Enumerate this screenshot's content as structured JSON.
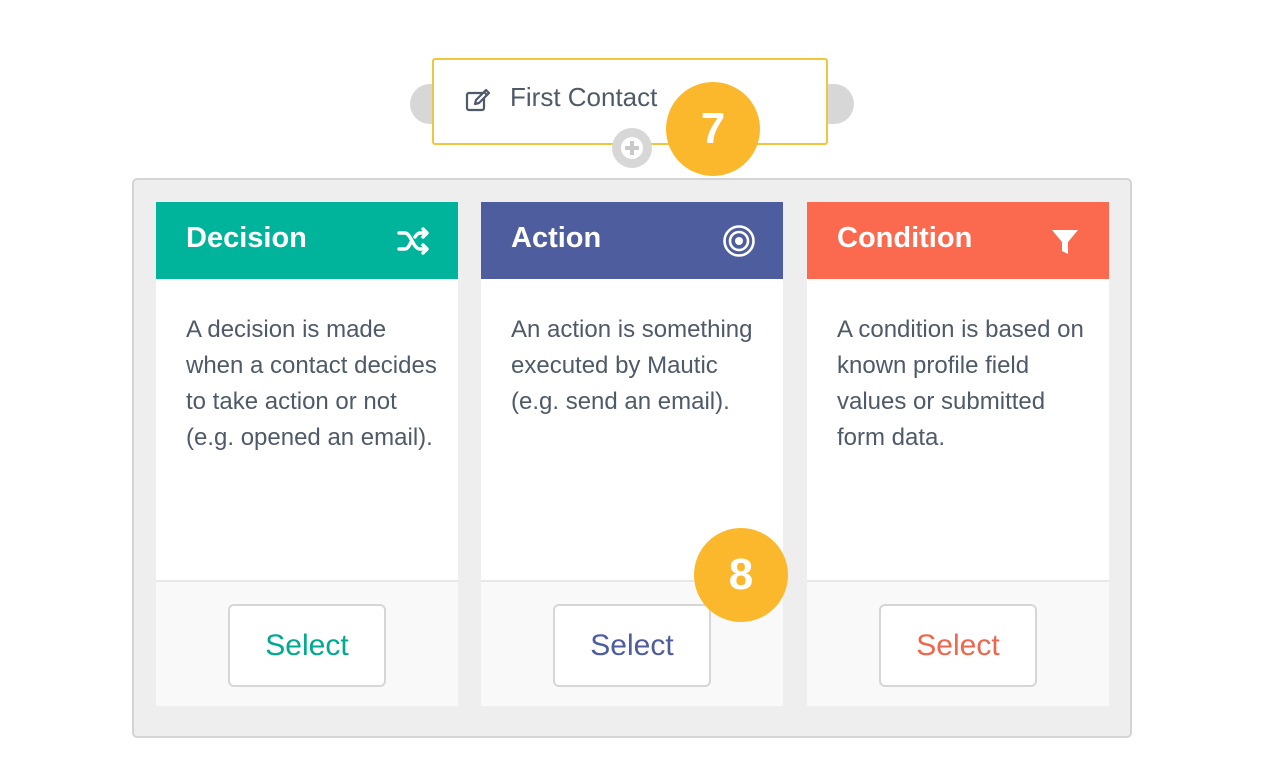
{
  "source_node": {
    "label": "First Contact",
    "icon": "edit-icon"
  },
  "badges": {
    "step_7": "7",
    "step_8": "8"
  },
  "colors": {
    "decision": "#00b49c",
    "action": "#4e5d9d",
    "condition": "#fb6a4f",
    "badge": "#fbb82c",
    "node_border": "#f0c63c"
  },
  "cards": [
    {
      "title": "Decision",
      "icon": "shuffle-icon",
      "description": "A decision is made when a contact decides to take action or not (e.g. opened an email).",
      "button": "Select"
    },
    {
      "title": "Action",
      "icon": "bullseye-icon",
      "description": "An action is something executed by Mautic (e.g. send an email).",
      "button": "Select"
    },
    {
      "title": "Condition",
      "icon": "filter-icon",
      "description": "A condition is based on known profile field values or submitted form data.",
      "button": "Select"
    }
  ]
}
